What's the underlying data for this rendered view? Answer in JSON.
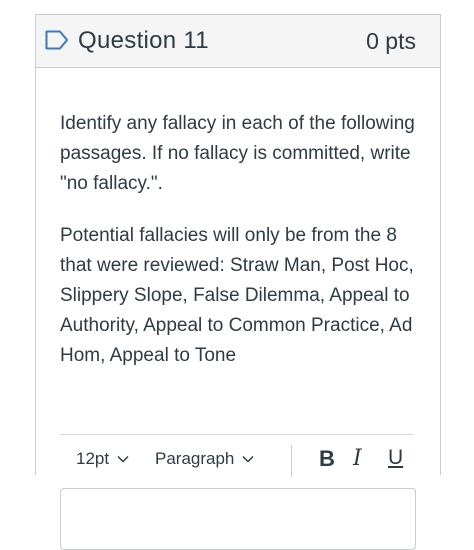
{
  "question": {
    "title": "Question 11",
    "points": "0 pts"
  },
  "content": {
    "paragraph1": "Identify any fallacy in each of the following passages. If no fallacy is committed, write \"no fallacy.\".",
    "paragraph2": "Potential fallacies will only be from the 8 that were reviewed: Straw Man, Post Hoc, Slippery Slope, False Dilemma, Appeal to Authority, Appeal to Common Practice, Ad Hom, Appeal to Tone"
  },
  "toolbar": {
    "font_size": "12pt",
    "block_format": "Paragraph",
    "bold_label": "B",
    "italic_label": "I",
    "underline_label": "U"
  },
  "colors": {
    "text": "#2d3b45",
    "border": "#c7cdd1",
    "header_bg": "#f5f5f5"
  }
}
